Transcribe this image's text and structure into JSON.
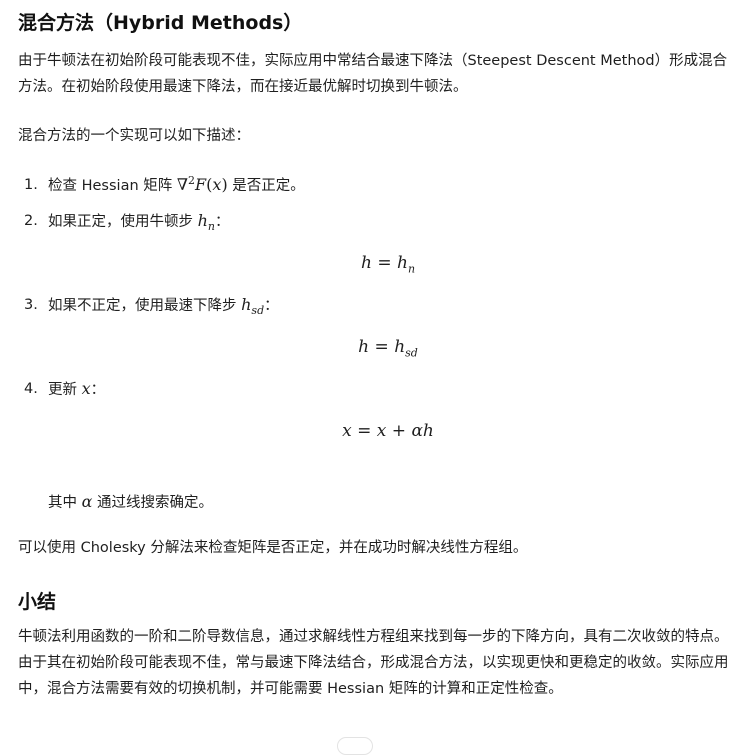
{
  "section1": {
    "title": "混合方法（Hybrid Methods）",
    "intro": "由于牛顿法在初始阶段可能表现不佳，实际应用中常结合最速下降法（Steepest Descent Method）形成混合方法。在初始阶段使用最速下降法，而在接近最优解时切换到牛顿法。",
    "desc": "混合方法的一个实现可以如下描述：",
    "steps": [
      {
        "num": "1.",
        "text_before": "检查 Hessian 矩阵 ",
        "math": "∇",
        "sup": "2",
        "math_after": "F",
        "paren_open": "(",
        "var": "x",
        "paren_close": ")",
        "text_after": " 是否正定。"
      },
      {
        "num": "2.",
        "text_before": "如果正定，使用牛顿步 ",
        "var": "h",
        "sub": "n",
        "text_after": "："
      },
      {
        "num": "3.",
        "text_before": "如果不正定，使用最速下降步 ",
        "var": "h",
        "sub": "sd",
        "text_after": "："
      },
      {
        "num": "4.",
        "text_before": "更新 ",
        "var": "x",
        "text_after": "："
      }
    ],
    "equations": [
      {
        "lhs": "h",
        "op": "=",
        "rhs": "h",
        "rhs_sub": "n"
      },
      {
        "lhs": "h",
        "op": "=",
        "rhs": "h",
        "rhs_sub": "sd"
      },
      {
        "lhs": "x",
        "op": "=",
        "rhs1": "x",
        "op2": "+",
        "rhs2": "αh"
      }
    ],
    "note_before": "其中 ",
    "note_var": "α",
    "note_after": " 通过线搜索确定。",
    "cholesky": "可以使用 Cholesky 分解法来检查矩阵是否正定，并在成功时解决线性方程组。"
  },
  "section2": {
    "title": "小结",
    "body": "牛顿法利用函数的一阶和二阶导数信息，通过求解线性方程组来找到每一步的下降方向，具有二次收敛的特点。由于其在初始阶段可能表现不佳，常与最速下降法结合，形成混合方法，以实现更快和更稳定的收敛。实际应用中，混合方法需要有效的切换机制，并可能需要 Hessian 矩阵的计算和正定性检查。"
  }
}
